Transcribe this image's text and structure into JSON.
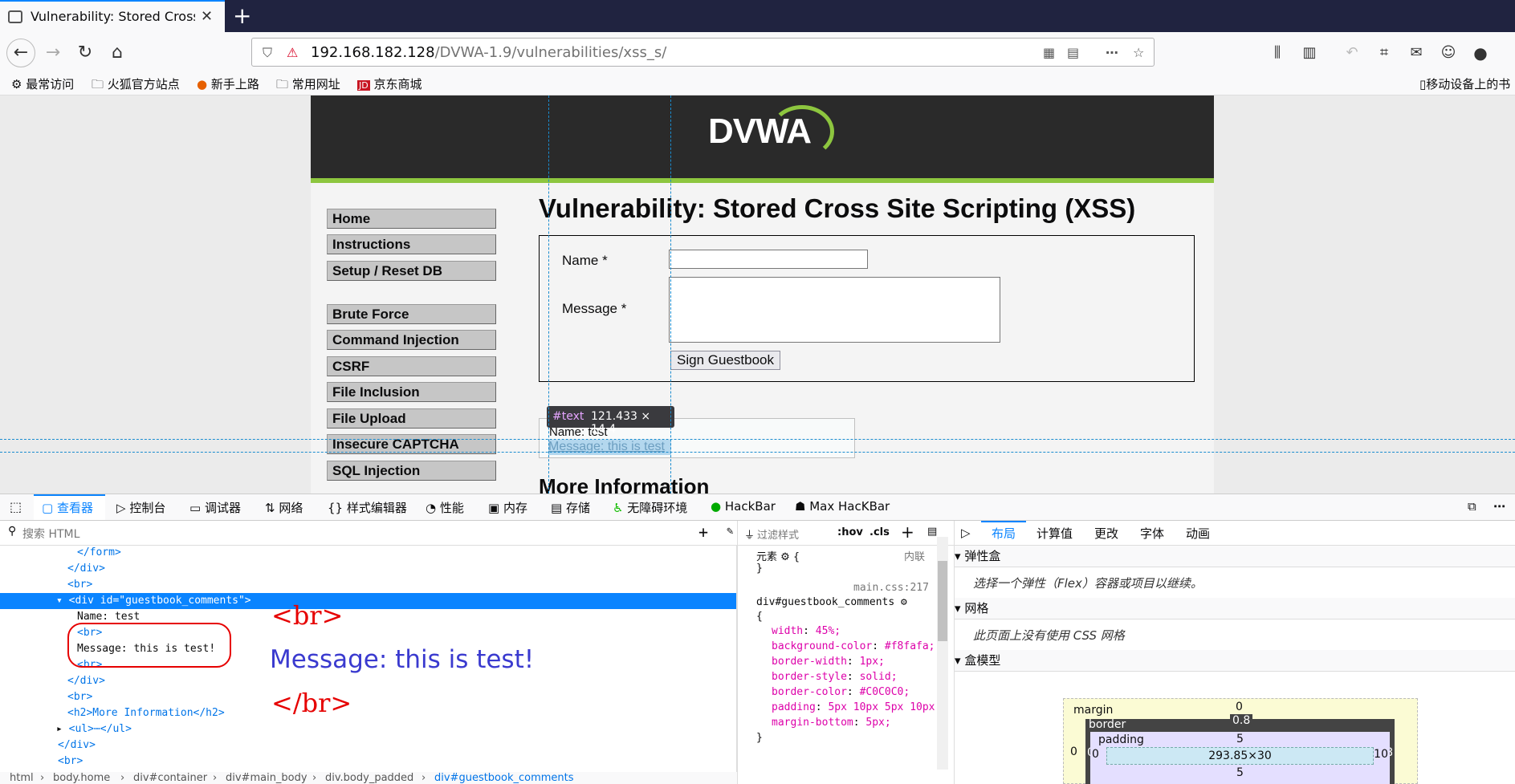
{
  "browser": {
    "tab_title": "Vulnerability: Stored Cross Si",
    "new_tab_label": "+",
    "url_host": "192.168.182.128",
    "url_path": "/DVWA-1.9/vulnerabilities/xss_s/",
    "bookmarks": [
      "最常访问",
      "火狐官方站点",
      "新手上路",
      "常用网址",
      "京东商城"
    ],
    "mobile_bookmarks": "移动设备上的书"
  },
  "page": {
    "logo": "DVWA",
    "menu": [
      "Home",
      "Instructions",
      "Setup / Reset DB",
      "Brute Force",
      "Command Injection",
      "CSRF",
      "File Inclusion",
      "File Upload",
      "Insecure CAPTCHA",
      "SQL Injection"
    ],
    "heading": "Vulnerability: Stored Cross Site Scripting (XSS)",
    "name_label": "Name *",
    "message_label": "Message *",
    "sign_button": "Sign Guestbook",
    "comment_name": "Name: test",
    "comment_message": "Message: this is test",
    "more_info": "More Information",
    "tooltip_node": "#text",
    "tooltip_size": "121.433 × 14.4"
  },
  "devtools": {
    "tabs": [
      "查看器",
      "控制台",
      "调试器",
      "网络",
      "样式编辑器",
      "性能",
      "内存",
      "存储",
      "无障碍环境",
      "HackBar",
      "Max HacKBar"
    ],
    "search_placeholder": "搜索 HTML",
    "markup_lines": [
      {
        "indent": 8,
        "text": "</form>"
      },
      {
        "indent": 7,
        "text": "</div>"
      },
      {
        "indent": 7,
        "text": "<br>"
      },
      {
        "indent": 7,
        "text": "<div id=\"guestbook_comments\">",
        "selected": true
      },
      {
        "indent": 8,
        "text": "Name: test"
      },
      {
        "indent": 8,
        "text": "<br>"
      },
      {
        "indent": 8,
        "text": "Message: this is test!"
      },
      {
        "indent": 8,
        "text": "<br>"
      },
      {
        "indent": 7,
        "text": "</div>"
      },
      {
        "indent": 7,
        "text": "<br>"
      },
      {
        "indent": 7,
        "text": "<h2>More Information</h2>"
      },
      {
        "indent": 7,
        "text": "<ul>⋯</ul>"
      },
      {
        "indent": 6,
        "text": "</div>"
      },
      {
        "indent": 6,
        "text": "<br>"
      }
    ],
    "annotations": {
      "br_open": "<br>",
      "message": "Message:  this is test!",
      "br_close": "</br>"
    },
    "breadcrumb": [
      "html",
      "body.home",
      "div#container",
      "div#main_body",
      "div.body_padded",
      "div#guestbook_comments"
    ],
    "rules": {
      "filter_placeholder": "过滤样式",
      "hov": ":hov",
      "cls": ".cls",
      "element_label": "元素",
      "inline_label": "内联",
      "source": "main.css:217",
      "selector": "div#guestbook_comments",
      "declarations": [
        {
          "prop": "width",
          "value": "45%;"
        },
        {
          "prop": "background-color",
          "value": "#f8fafa;"
        },
        {
          "prop": "border-width",
          "value": "1px;"
        },
        {
          "prop": "border-style",
          "value": "solid;"
        },
        {
          "prop": "border-color",
          "value": "#C0C0C0;"
        },
        {
          "prop": "padding",
          "value": "5px 10px 5px 10px;"
        },
        {
          "prop": "margin-bottom",
          "value": "5px;"
        }
      ]
    },
    "layout_tabs": [
      "布局",
      "计算值",
      "更改",
      "字体",
      "动画"
    ],
    "flex_section": "弹性盒",
    "flex_note": "选择一个弹性（Flex）容器或项目以继续。",
    "grid_section": "网格",
    "grid_note": "此页面上没有使用 CSS 网格",
    "boxmodel_section": "盒模型",
    "boxmodel": {
      "margin_label": "margin",
      "margin_top": "0",
      "border_label": "border",
      "border_val": "0.8",
      "padding_label": "padding",
      "padding_val": "5",
      "content": "293.85×30",
      "left_val": "0",
      "right_val": "10"
    }
  }
}
